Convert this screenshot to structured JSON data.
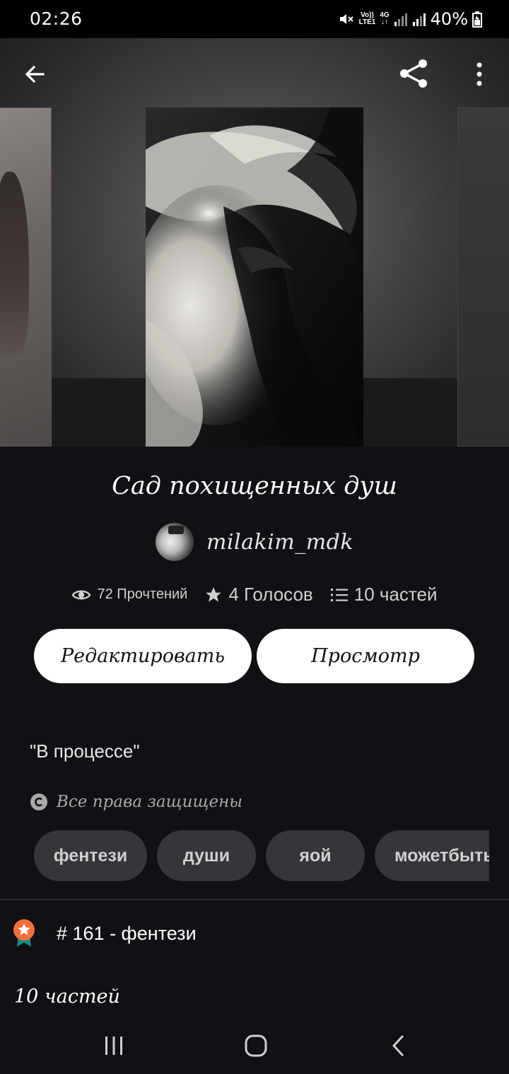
{
  "status_bar": {
    "time": "02:26",
    "network_top": "Vo))",
    "network_bottom": "LTE1",
    "network_type": "4G",
    "battery": "40%"
  },
  "header": {
    "back_icon": "arrow-left-icon",
    "share_icon": "share-icon",
    "more_icon": "more-vertical-icon"
  },
  "book": {
    "title": "Сад похищенных душ",
    "author": "milakim_mdk",
    "reads": "72 Прочтений",
    "votes": "4 Голосов",
    "parts": "10 частей",
    "status": "\"В процессе\"",
    "copyright": "Все права защищены"
  },
  "actions": {
    "edit_label": "Редактировать",
    "view_label": "Просмотр"
  },
  "tags": [
    "фентези",
    "души",
    "яой",
    "можетбыть"
  ],
  "ranking": {
    "text": "# 161 - фентези"
  },
  "toc": {
    "parts_label": "10 частей"
  },
  "colors": {
    "background": "#121014",
    "tag_background": "#36353a",
    "badge_orange": "#f26f3d",
    "badge_teal": "#1a8a87"
  }
}
